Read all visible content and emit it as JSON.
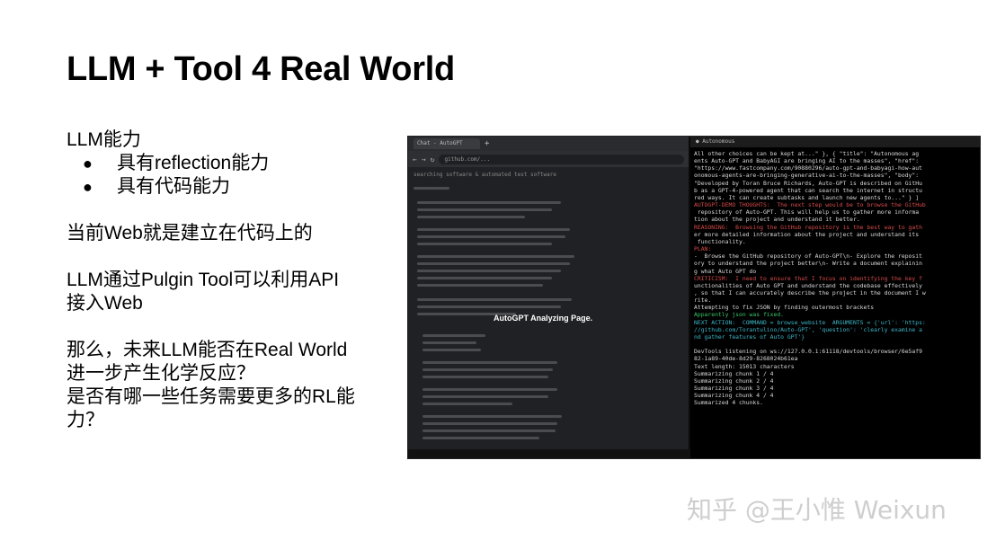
{
  "slide": {
    "title": "LLM + Tool 4 Real World",
    "heading1": "LLM能力",
    "bullets": [
      "具有reflection能力",
      "具有代码能力"
    ],
    "bullet_glyph": "●",
    "para1": "当前Web就是建立在代码上的",
    "para2_line1": "LLM通过Pulgin Tool可以利用API",
    "para2_line2": "接入Web",
    "para3_line1": "那么，未来LLM能否在Real World",
    "para3_line2": "进一步产生化学反应？",
    "para3_line3": "是否有哪一些任务需要更多的RL能",
    "para3_line4": "力？"
  },
  "screenshot": {
    "browser_tab": "Chat - AutoGPT",
    "tab_add": "+",
    "url": "github.com/...",
    "search_line": "searching software & automated test software",
    "overlay_label": "AutoGPT Analyzing Page.",
    "terminal_tab": "● Autonomous",
    "terminal_lines": [
      {
        "text": "All other choices can be kept at...\" }, { \"title\": \"Autonomous ag",
        "color": "white"
      },
      {
        "text": "ents Auto-GPT and BabyAGI are bringing AI to the masses\", \"href\":",
        "color": "white"
      },
      {
        "text": "\"https://www.fastcompany.com/90880296/auto-gpt-and-babyagi-how-aut",
        "color": "white"
      },
      {
        "text": "onomous-agents-are-bringing-generative-ai-to-the-masses\", \"body\":",
        "color": "white"
      },
      {
        "text": "\"Developed by Toran Bruce Richards, Auto-GPT is described on GitHu",
        "color": "white"
      },
      {
        "text": "b as a GPT-4-powered agent that can search the internet in structu",
        "color": "white"
      },
      {
        "text": "red ways. It can create subtasks and launch new agents to...\" } ]",
        "color": "white"
      },
      {
        "text": "AUTOGPT-DEMO THOUGHTS:  The next step would be to browse the GitHub",
        "color": "red"
      },
      {
        "text": " repository of Auto-GPT. This will help us to gather more informa",
        "color": "white"
      },
      {
        "text": "tion about the project and understand it better.",
        "color": "white"
      },
      {
        "text": "REASONING:  Browsing the GitHub repository is the best way to gath",
        "color": "red"
      },
      {
        "text": "er more detailed information about the project and understand its",
        "color": "white"
      },
      {
        "text": " functionality.",
        "color": "white"
      },
      {
        "text": "PLAN:",
        "color": "red"
      },
      {
        "text": "-  Browse the GitHub repository of Auto-GPT\\n- Explore the reposit",
        "color": "white"
      },
      {
        "text": "ory to understand the project better\\n- Write a document explainin",
        "color": "white"
      },
      {
        "text": "g what Auto GPT do",
        "color": "white"
      },
      {
        "text": "CRITICISM:  I need to ensure that I focus on identifying the key f",
        "color": "red"
      },
      {
        "text": "unctionalities of Auto GPT and understand the codebase effectively",
        "color": "white"
      },
      {
        "text": ", so that I can accurately describe the project in the document I w",
        "color": "white"
      },
      {
        "text": "rite.",
        "color": "white"
      },
      {
        "text": "Attempting to fix JSON by finding outermost brackets",
        "color": "white"
      },
      {
        "text": "Apparently json was fixed.",
        "color": "green"
      },
      {
        "text": "NEXT ACTION:  COMMAND = browse_website  ARGUMENTS = {'url': 'https:",
        "color": "cyan"
      },
      {
        "text": "//github.com/Torantulino/Auto-GPT', 'question': 'clearly examine a",
        "color": "cyan"
      },
      {
        "text": "nd gather features of Auto GPT'}",
        "color": "cyan"
      },
      {
        "text": "",
        "color": "white"
      },
      {
        "text": "DevTools listening on ws://127.0.0.1:61118/devtools/browser/6e5af9",
        "color": "white"
      },
      {
        "text": "82-1a89-40de-8d29-8268024b61ea",
        "color": "white"
      },
      {
        "text": "Text length: 15013 characters",
        "color": "white"
      },
      {
        "text": "Summarizing chunk 1 / 4",
        "color": "white"
      },
      {
        "text": "Summarizing chunk 2 / 4",
        "color": "white"
      },
      {
        "text": "Summarizing chunk 3 / 4",
        "color": "white"
      },
      {
        "text": "Summarizing chunk 4 / 4",
        "color": "white"
      },
      {
        "text": "Summarized 4 chunks.",
        "color": "white"
      }
    ]
  },
  "watermark": "知乎 @王小惟 Weixun",
  "colors": {
    "terminal_red": "#d94b4b",
    "terminal_green": "#39c66b",
    "terminal_cyan": "#3bb7c9",
    "terminal_white": "#d8d8d8"
  }
}
